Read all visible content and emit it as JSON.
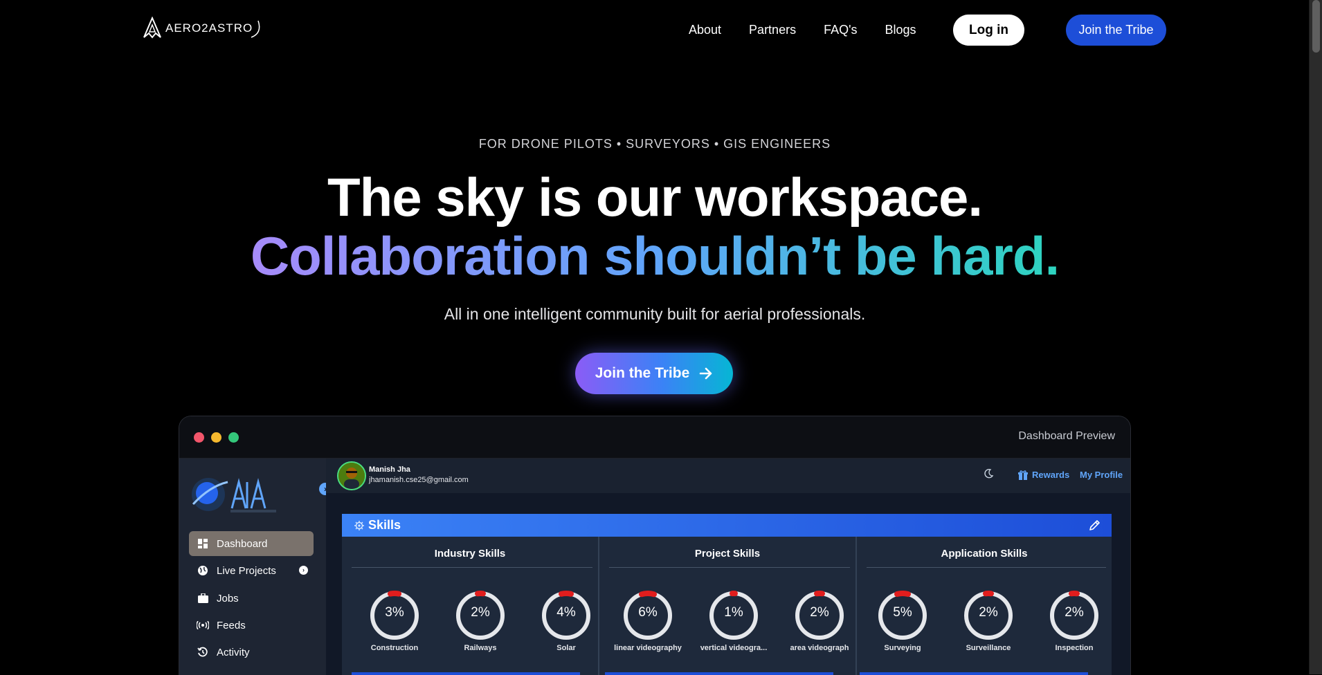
{
  "nav": {
    "logo_text": "AERO2ASTRO",
    "links": [
      "About",
      "Partners",
      "FAQ's",
      "Blogs"
    ],
    "login": "Log in",
    "join": "Join the Tribe"
  },
  "hero": {
    "eyebrow": "FOR DRONE PILOTS • SURVEYORS • GIS ENGINEERS",
    "headline": "The sky is our workspace.",
    "headline_gradient": "Collaboration shouldn’t be hard.",
    "subtitle": "All in one intelligent community built for aerial professionals.",
    "cta": "Join the Tribe",
    "cta_icon": "arrow-right-icon"
  },
  "window": {
    "title": "Dashboard Preview",
    "dot_colors": [
      "#f2566b",
      "#f5b82e",
      "#34c77b"
    ]
  },
  "dashboard": {
    "sidebar": [
      {
        "label": "Dashboard",
        "icon": "grid-icon",
        "active": true
      },
      {
        "label": "Live Projects",
        "icon": "globe-icon",
        "has_chevron": true
      },
      {
        "label": "Jobs",
        "icon": "briefcase-icon"
      },
      {
        "label": "Feeds",
        "icon": "broadcast-icon"
      },
      {
        "label": "Activity",
        "icon": "history-icon"
      }
    ],
    "user": {
      "name": "Manish Jha",
      "email": "jhamanish.cse25@gmail.com"
    },
    "topbar": {
      "rewards": "Rewards",
      "profile": "My Profile"
    },
    "skills": {
      "title": "Skills",
      "columns": [
        {
          "title": "Industry Skills",
          "items": [
            {
              "pct": "3%",
              "label": "Construction"
            },
            {
              "pct": "2%",
              "label": "Railways"
            },
            {
              "pct": "4%",
              "label": "Solar"
            }
          ]
        },
        {
          "title": "Project Skills",
          "items": [
            {
              "pct": "6%",
              "label": "linear videography"
            },
            {
              "pct": "1%",
              "label": "vertical videogra..."
            },
            {
              "pct": "2%",
              "label": "area videograph"
            }
          ]
        },
        {
          "title": "Application Skills",
          "items": [
            {
              "pct": "5%",
              "label": "Surveying"
            },
            {
              "pct": "2%",
              "label": "Surveillance"
            },
            {
              "pct": "2%",
              "label": "Inspection"
            }
          ]
        }
      ]
    }
  }
}
